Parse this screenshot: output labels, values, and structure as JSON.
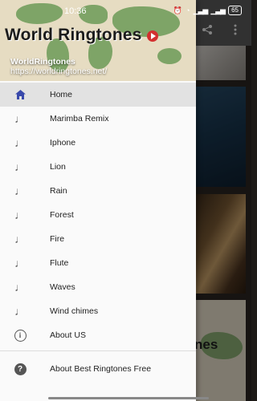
{
  "status_bar": {
    "time": "10:36",
    "battery": "65"
  },
  "header": {
    "logo_text": "World Ringtones",
    "app_name": "WorldRingtones",
    "url": "https://worldringtones.net/"
  },
  "menu": {
    "items": [
      {
        "label": "Home",
        "icon": "home-icon",
        "active": true
      },
      {
        "label": "Marimba Remix",
        "icon": "music-note-icon"
      },
      {
        "label": "Iphone",
        "icon": "music-note-icon"
      },
      {
        "label": "Lion",
        "icon": "music-note-icon"
      },
      {
        "label": "Rain",
        "icon": "music-note-icon"
      },
      {
        "label": "Forest",
        "icon": "music-note-icon"
      },
      {
        "label": "Fire",
        "icon": "music-note-icon"
      },
      {
        "label": "Flute",
        "icon": "music-note-icon"
      },
      {
        "label": "Waves",
        "icon": "music-note-icon"
      },
      {
        "label": "Wind chimes",
        "icon": "music-note-icon"
      },
      {
        "label": "About US",
        "icon": "info-icon"
      }
    ],
    "footer_item": {
      "label": "About Best Ringtones Free",
      "icon": "help-icon"
    }
  },
  "background_app": {
    "actions": [
      "share-icon",
      "more-vert-icon"
    ],
    "tile_text": "nes"
  },
  "colors": {
    "active_icon": "#3949ab",
    "drawer_bg": "#fafafa",
    "active_bg": "#e2e2e2"
  }
}
